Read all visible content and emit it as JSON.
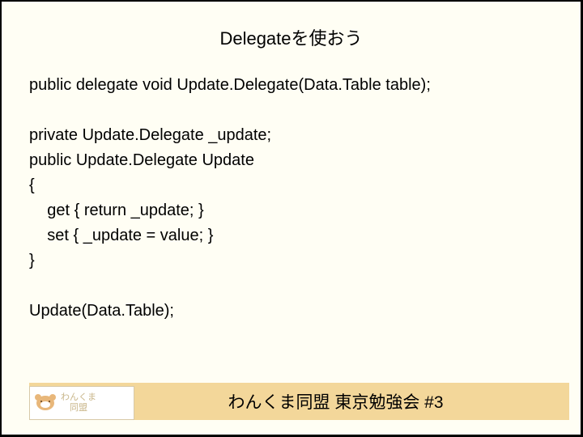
{
  "title": "Delegateを使おう",
  "code": {
    "l1": "public delegate void Update.Delegate(Data.Table table);",
    "l2": "private Update.Delegate _update;",
    "l3": "public Update.Delegate Update",
    "l4": "{",
    "l5": "    get { return _update; }",
    "l6": "    set { _update = value; }",
    "l7": "}",
    "l8": "Update(Data.Table);"
  },
  "logo": {
    "line1": "わんくま",
    "line2": "　同盟"
  },
  "footer": "わんくま同盟 東京勉強会 #3"
}
